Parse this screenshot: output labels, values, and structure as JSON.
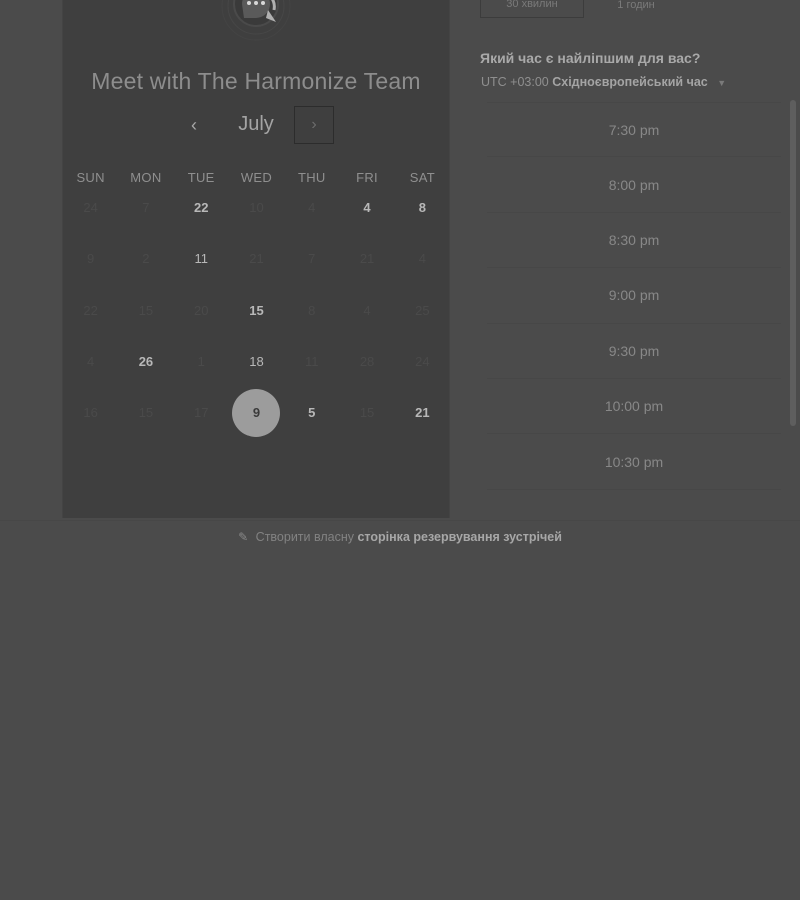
{
  "calendar": {
    "title": "Meet with The Harmonize Team",
    "month": "July",
    "prev_icon": "‹",
    "next_icon": "›",
    "weekdays": [
      "SUN",
      "MON",
      "TUE",
      "WED",
      "THU",
      "FRI",
      "SAT"
    ],
    "weeks": [
      [
        {
          "d": "24",
          "a": false
        },
        {
          "d": "7",
          "a": false
        },
        {
          "d": "22",
          "a": true
        },
        {
          "d": "10",
          "a": false
        },
        {
          "d": "4",
          "a": false
        },
        {
          "d": "4",
          "a": true
        },
        {
          "d": "8",
          "a": true
        }
      ],
      [
        {
          "d": "9",
          "a": false
        },
        {
          "d": "2",
          "a": false
        },
        {
          "d": "11",
          "a": true
        },
        {
          "d": "21",
          "a": false
        },
        {
          "d": "7",
          "a": false
        },
        {
          "d": "21",
          "a": false
        },
        {
          "d": "4",
          "a": false
        }
      ],
      [
        {
          "d": "22",
          "a": false
        },
        {
          "d": "15",
          "a": false
        },
        {
          "d": "20",
          "a": false
        },
        {
          "d": "15",
          "a": true
        },
        {
          "d": "8",
          "a": false
        },
        {
          "d": "4",
          "a": false
        },
        {
          "d": "25",
          "a": false
        }
      ],
      [
        {
          "d": "4",
          "a": false
        },
        {
          "d": "26",
          "a": true
        },
        {
          "d": "1",
          "a": false
        },
        {
          "d": "18",
          "a": true
        },
        {
          "d": "11",
          "a": false
        },
        {
          "d": "28",
          "a": false
        },
        {
          "d": "24",
          "a": false
        }
      ],
      [
        {
          "d": "16",
          "a": false
        },
        {
          "d": "15",
          "a": false
        },
        {
          "d": "17",
          "a": false
        },
        {
          "d": "9",
          "a": true,
          "selected": true
        },
        {
          "d": "5",
          "a": true
        },
        {
          "d": "15",
          "a": false
        },
        {
          "d": "21",
          "a": true
        }
      ]
    ]
  },
  "durations": [
    "30 хвилин",
    "1 годин"
  ],
  "question": "Який час є найліпшим для вас?",
  "timezone": {
    "offset": "UTC +03:00",
    "name": "Східноєвропейський час"
  },
  "slots": [
    "7:30 pm",
    "8:00 pm",
    "8:30 pm",
    "9:00 pm",
    "9:30 pm",
    "10:00 pm",
    "10:30 pm"
  ],
  "footer": {
    "prefix": "Створити власну",
    "link": "сторінка резервування зустрічей"
  },
  "colors": {
    "background": "#4b4b4b",
    "card": "#3f3f3f",
    "selected": "#9c9c9c"
  }
}
